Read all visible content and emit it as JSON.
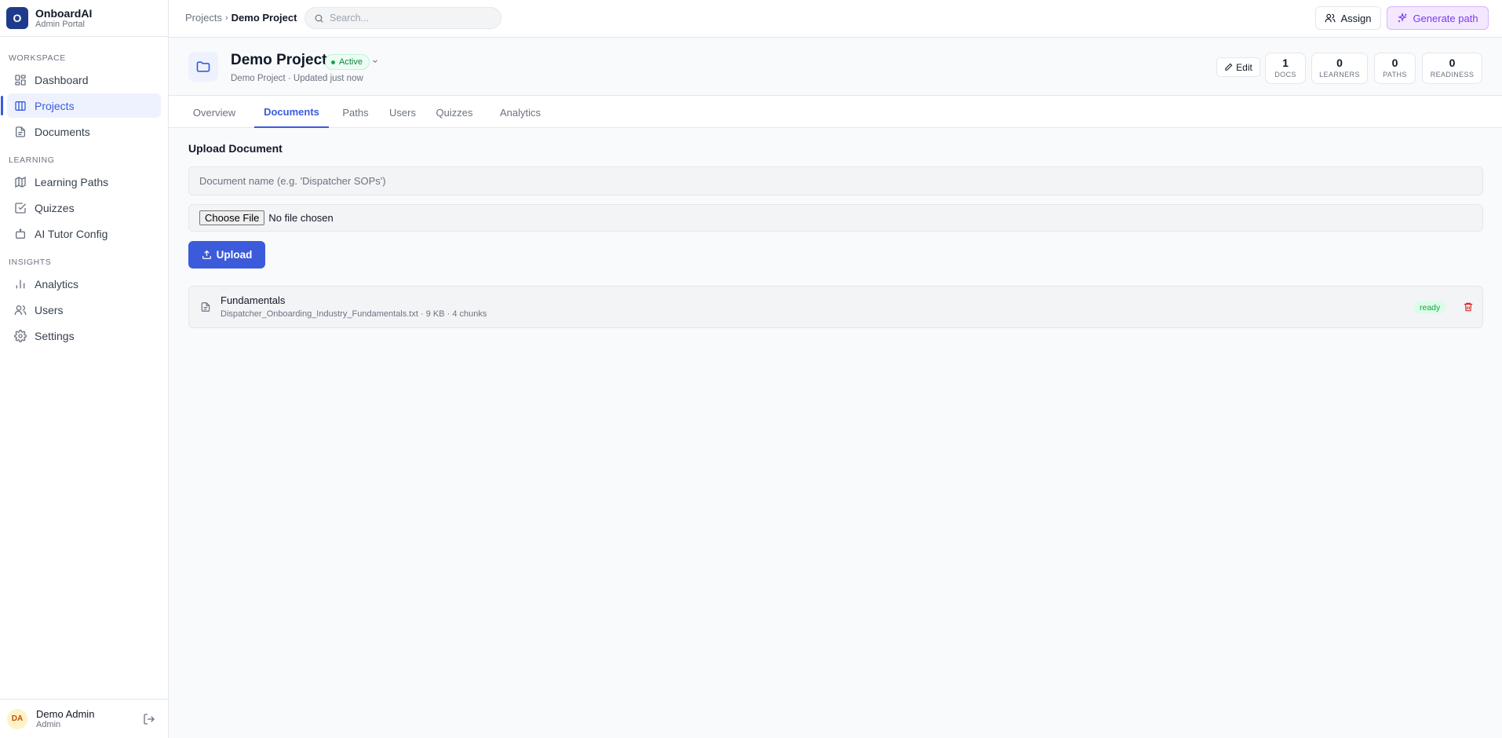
{
  "app": {
    "name": "OnboardAI",
    "subtitle": "Admin Portal",
    "logo_letter": "O"
  },
  "sidebar": {
    "sections": [
      {
        "label": "WORKSPACE",
        "items": [
          {
            "label": "Dashboard",
            "icon": "dashboard-icon"
          },
          {
            "label": "Projects",
            "icon": "projects-icon",
            "active": true
          },
          {
            "label": "Documents",
            "icon": "document-icon"
          }
        ]
      },
      {
        "label": "LEARNING",
        "items": [
          {
            "label": "Learning Paths",
            "icon": "map-icon"
          },
          {
            "label": "Quizzes",
            "icon": "checkbox-icon"
          },
          {
            "label": "AI Tutor Config",
            "icon": "bot-icon"
          }
        ]
      },
      {
        "label": "INSIGHTS",
        "items": [
          {
            "label": "Analytics",
            "icon": "bar-chart-icon"
          },
          {
            "label": "Users",
            "icon": "users-icon"
          },
          {
            "label": "Settings",
            "icon": "gear-icon"
          }
        ]
      }
    ],
    "user": {
      "initials": "DA",
      "name": "Demo Admin",
      "role": "Admin"
    }
  },
  "topbar": {
    "breadcrumb": {
      "parent": "Projects",
      "separator": "›",
      "current": "Demo Project"
    },
    "search_placeholder": "Search...",
    "assign_label": "Assign",
    "generate_label": "Generate path"
  },
  "project": {
    "title": "Demo Project",
    "status": "Active",
    "name": "Demo Project",
    "updated": "Updated just now",
    "sub_separator": " · ",
    "edit_label": "Edit",
    "stats": [
      {
        "value": "1",
        "label": "DOCS"
      },
      {
        "value": "0",
        "label": "LEARNERS"
      },
      {
        "value": "0",
        "label": "PATHS"
      },
      {
        "value": "0",
        "label": "READINESS"
      }
    ]
  },
  "tabs": [
    {
      "label": "Overview"
    },
    {
      "label": "Documents",
      "active": true
    },
    {
      "label": "Paths"
    },
    {
      "label": "Users"
    },
    {
      "label": "Quizzes"
    },
    {
      "label": "Analytics"
    }
  ],
  "upload": {
    "title": "Upload Document",
    "name_placeholder": "Document name (e.g. 'Dispatcher SOPs')",
    "choose_file_label": "Choose File",
    "no_file_text": "No file chosen",
    "upload_label": "Upload"
  },
  "documents": [
    {
      "title": "Fundamentals",
      "filename": "Dispatcher_Onboarding_Industry_Fundamentals.txt",
      "size": "9 KB",
      "chunks": "4 chunks",
      "separator": " · ",
      "status": "ready"
    }
  ],
  "colors": {
    "accent": "#3b5bdb",
    "success": "#16a34a",
    "danger": "#dc2626",
    "purple": "#7c3aed"
  }
}
